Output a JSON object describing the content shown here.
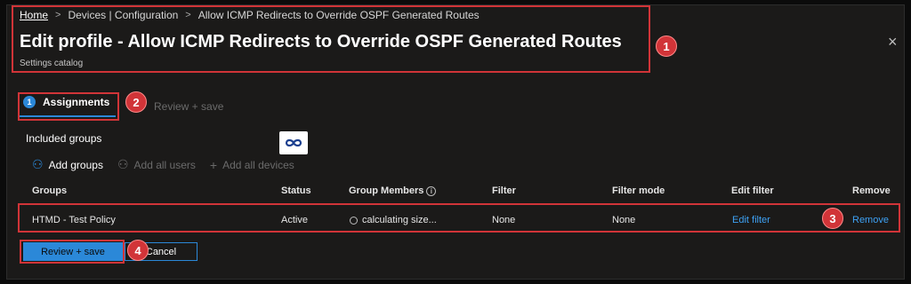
{
  "breadcrumb": {
    "home": "Home",
    "items": [
      "Devices | Configuration",
      "Allow ICMP Redirects to Override OSPF Generated Routes"
    ]
  },
  "header": {
    "title": "Edit profile - Allow ICMP Redirects to Override OSPF Generated Routes",
    "subtitle": "Settings catalog",
    "close_icon": "×"
  },
  "tabs": {
    "assignments": {
      "number": "1",
      "label": "Assignments"
    },
    "review": {
      "label": "Review + save"
    }
  },
  "section": {
    "included_label": "Included groups"
  },
  "actions": [
    {
      "label": "Add groups",
      "icon": "add-group-icon",
      "glyph": "⚇"
    },
    {
      "label": "Add all users",
      "icon": "add-users-icon",
      "glyph": "⚇"
    },
    {
      "label": "Add all devices",
      "icon": "plus-icon",
      "glyph": "+"
    }
  ],
  "table": {
    "headers": [
      "Groups",
      "Status",
      "Group Members",
      "Filter",
      "Filter mode",
      "Edit filter",
      "Remove"
    ],
    "rows": [
      [
        "HTMD - Test Policy",
        "Active",
        "calculating size...",
        "None",
        "None",
        "Edit filter",
        "Remove"
      ]
    ]
  },
  "buttons": {
    "review_save": "Review + save",
    "cancel": "Cancel"
  },
  "annotations": [
    "1",
    "2",
    "3",
    "4"
  ],
  "colors": {
    "accent": "#2b88d8",
    "annotation": "#d13438",
    "background": "#1b1a19",
    "link": "#3ea2f5"
  }
}
